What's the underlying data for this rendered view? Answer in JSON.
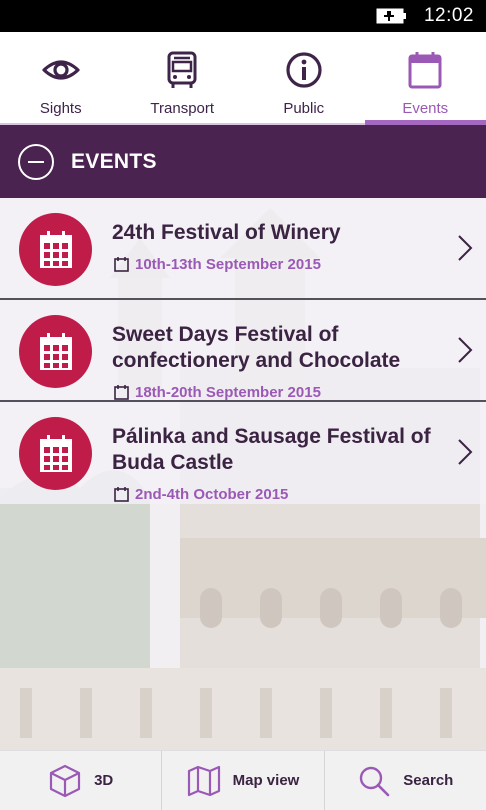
{
  "status_bar": {
    "time": "12:02",
    "battery_icon": "battery-charging-icon"
  },
  "tabs": [
    {
      "label": "Sights",
      "icon": "eye-icon",
      "active": false
    },
    {
      "label": "Transport",
      "icon": "bus-icon",
      "active": false
    },
    {
      "label": "Public",
      "icon": "info-icon",
      "active": false
    },
    {
      "label": "Events",
      "icon": "calendar-icon",
      "active": true
    }
  ],
  "section": {
    "title": "EVENTS",
    "collapse_icon": "minus-circle-icon"
  },
  "events": [
    {
      "title": "24th Festival of Winery",
      "date": "10th-13th September 2015"
    },
    {
      "title": "Sweet Days Festival of confectionery and Chocolate",
      "date": "18th-20th September 2015"
    },
    {
      "title": "Pálinka and Sausage Festival of Buda Castle",
      "date": "2nd-4th October 2015"
    }
  ],
  "bottom_bar": [
    {
      "label": "3D",
      "icon": "cube-icon"
    },
    {
      "label": "Map view",
      "icon": "map-icon"
    },
    {
      "label": "Search",
      "icon": "search-icon"
    }
  ],
  "colors": {
    "accent": "#9b59b6",
    "header_bg": "#4a2350",
    "badge": "#c01c4a",
    "text_dark": "#3b2342"
  }
}
